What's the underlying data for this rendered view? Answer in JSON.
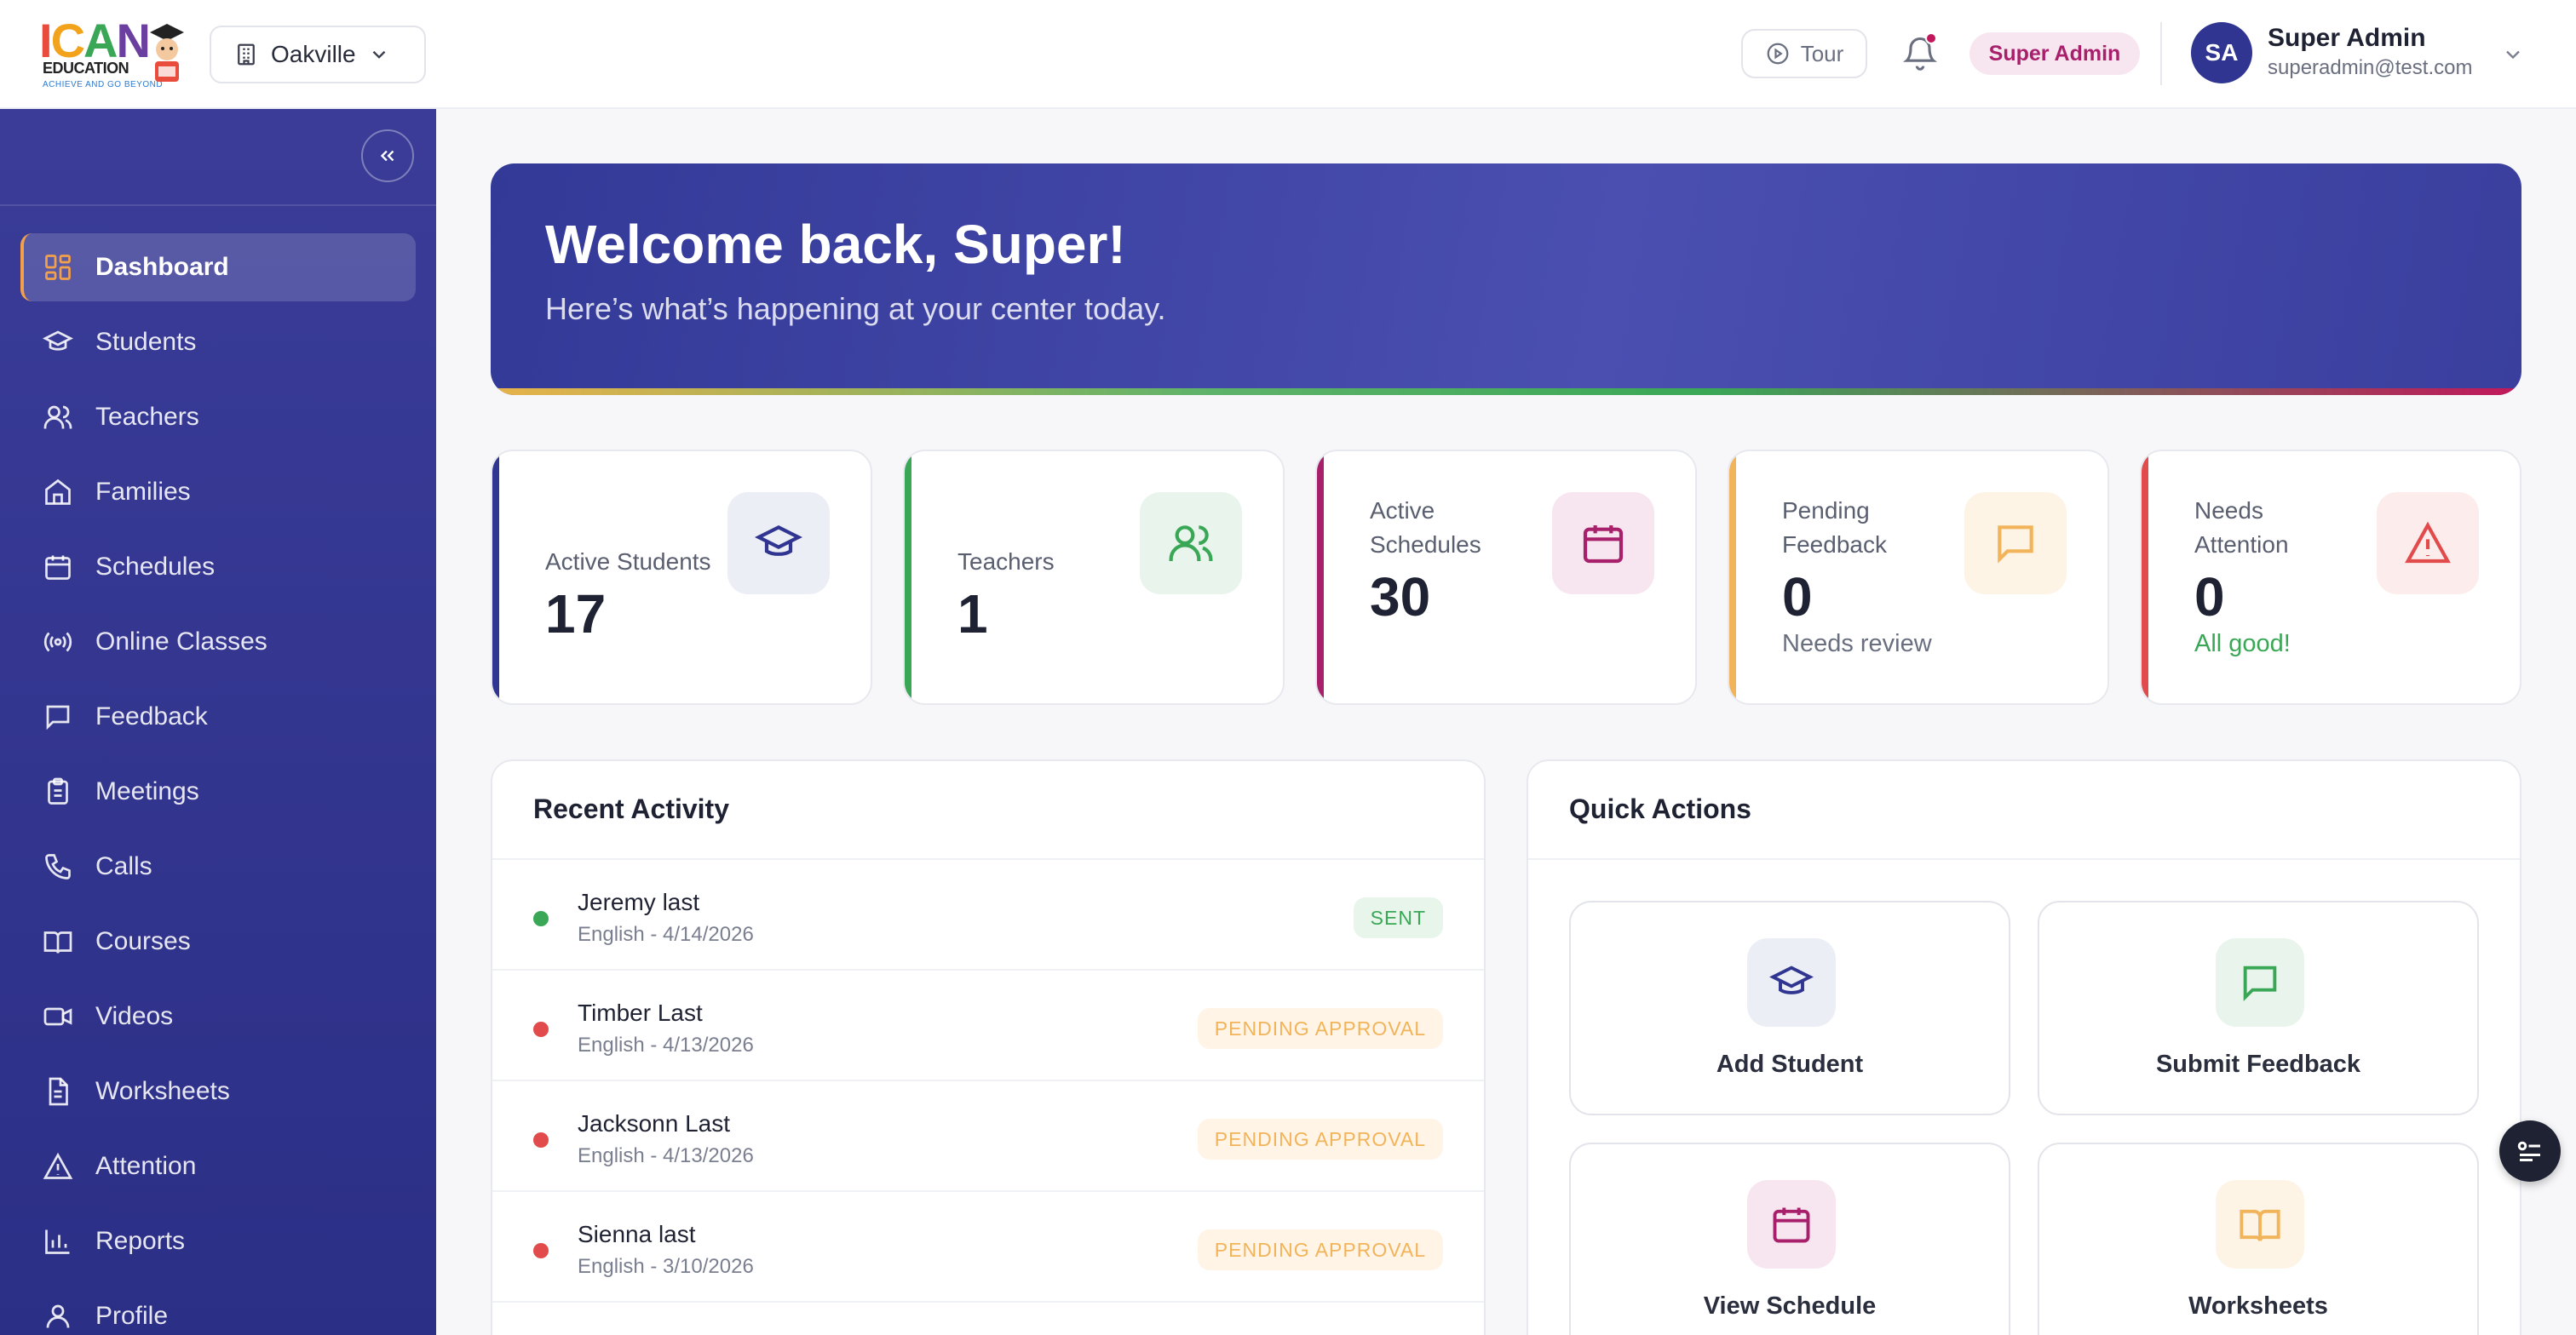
{
  "header": {
    "logo": {
      "main": [
        "I",
        "C",
        "A",
        "N"
      ],
      "sub": "EDUCATION",
      "tagline": "ACHIEVE AND GO BEYOND"
    },
    "location": "Oakville",
    "tour_label": "Tour",
    "role_badge": "Super Admin",
    "user": {
      "initials": "SA",
      "name": "Super Admin",
      "email": "superadmin@test.com"
    }
  },
  "sidebar": {
    "items": [
      {
        "label": "Dashboard",
        "icon": "grid-icon",
        "active": true
      },
      {
        "label": "Students",
        "icon": "graduation-cap-icon"
      },
      {
        "label": "Teachers",
        "icon": "users-icon"
      },
      {
        "label": "Families",
        "icon": "home-icon"
      },
      {
        "label": "Schedules",
        "icon": "calendar-icon"
      },
      {
        "label": "Online Classes",
        "icon": "broadcast-icon"
      },
      {
        "label": "Feedback",
        "icon": "message-icon"
      },
      {
        "label": "Meetings",
        "icon": "clipboard-icon"
      },
      {
        "label": "Calls",
        "icon": "phone-icon"
      },
      {
        "label": "Courses",
        "icon": "book-icon"
      },
      {
        "label": "Videos",
        "icon": "video-icon"
      },
      {
        "label": "Worksheets",
        "icon": "file-icon"
      },
      {
        "label": "Attention",
        "icon": "alert-icon"
      },
      {
        "label": "Reports",
        "icon": "bar-chart-icon"
      },
      {
        "label": "Profile",
        "icon": "user-icon"
      }
    ]
  },
  "hero": {
    "title": "Welcome back, Super!",
    "subtitle": "Here’s what’s happening at your center today."
  },
  "stats": [
    {
      "label_lines": [
        "Active Students"
      ],
      "value": "17",
      "note": "",
      "color": "#2f3590",
      "icon": "graduation-cap-icon"
    },
    {
      "label_lines": [
        "Teachers"
      ],
      "value": "1",
      "note": "",
      "color": "#3aa757",
      "icon": "users-icon"
    },
    {
      "label_lines": [
        "Active",
        "Schedules"
      ],
      "value": "30",
      "note": "",
      "color": "#a8206b",
      "icon": "calendar-icon"
    },
    {
      "label_lines": [
        "Pending",
        "Feedback"
      ],
      "value": "0",
      "note": "Needs review",
      "color": "#f2b45a",
      "icon": "message-icon"
    },
    {
      "label_lines": [
        "Needs",
        "Attention"
      ],
      "value": "0",
      "note": "All good!",
      "color": "#e24b4b",
      "icon": "alert-icon"
    }
  ],
  "recent_activity": {
    "title": "Recent Activity",
    "items": [
      {
        "name": "Jeremy last",
        "detail": "English - 4/14/2026",
        "status": "SENT",
        "dot_color": "#3aa757"
      },
      {
        "name": "Timber Last",
        "detail": "English - 4/13/2026",
        "status": "PENDING APPROVAL",
        "dot_color": "#e24b4b"
      },
      {
        "name": "Jacksonn Last",
        "detail": "English - 4/13/2026",
        "status": "PENDING APPROVAL",
        "dot_color": "#e24b4b"
      },
      {
        "name": "Sienna last",
        "detail": "English - 3/10/2026",
        "status": "PENDING APPROVAL",
        "dot_color": "#e24b4b"
      }
    ]
  },
  "quick_actions": {
    "title": "Quick Actions",
    "items": [
      {
        "label": "Add Student",
        "icon": "graduation-cap-icon"
      },
      {
        "label": "Submit Feedback",
        "icon": "message-icon"
      },
      {
        "label": "View Schedule",
        "icon": "calendar-icon"
      },
      {
        "label": "Worksheets",
        "icon": "book-icon"
      }
    ]
  }
}
